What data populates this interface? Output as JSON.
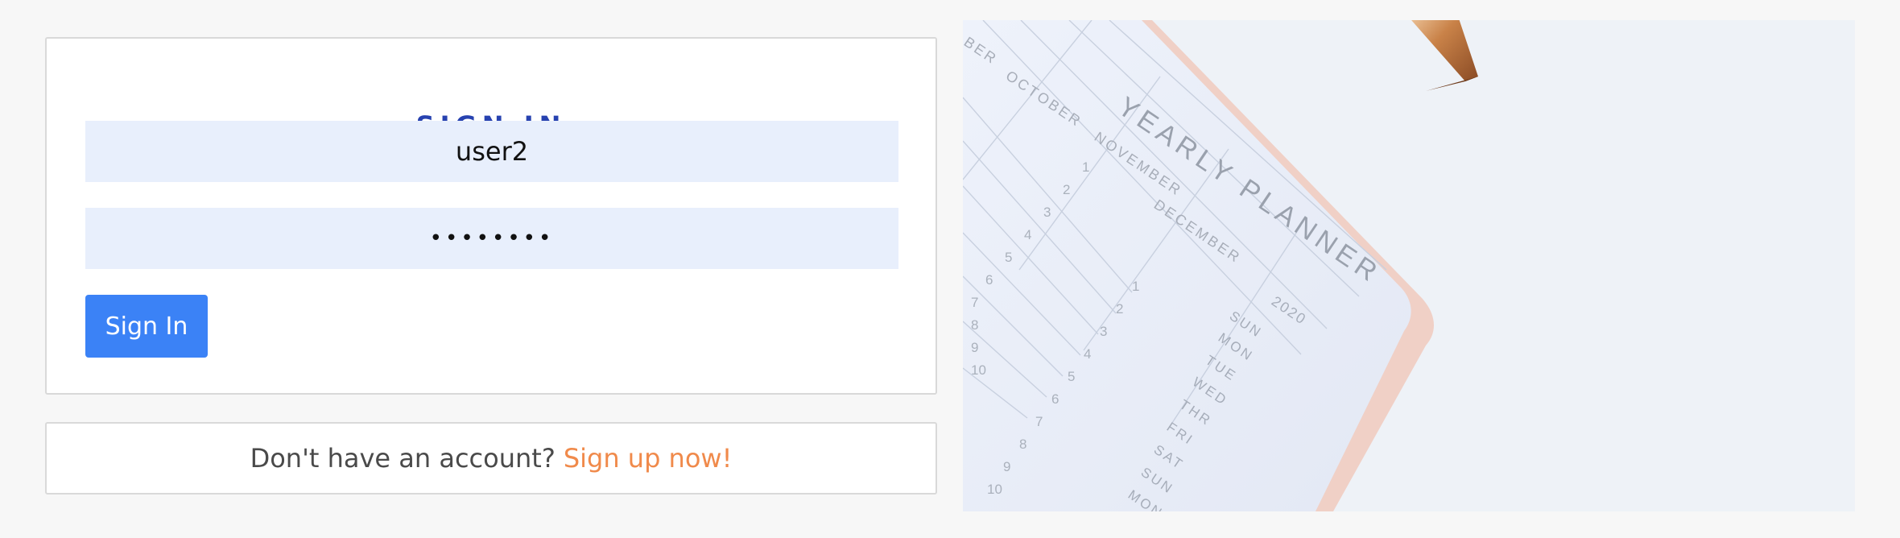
{
  "signin": {
    "title": "SIGN IN",
    "username_value": "user2",
    "password_value": "••••••••",
    "submit_label": "Sign In"
  },
  "signup": {
    "prompt": "Don't have an account?",
    "link_label": "Sign up now!"
  },
  "hero": {
    "planner_title": "YEARLY PLANNER",
    "year": "2020",
    "months": [
      "BER",
      "OCTOBER",
      "NOVEMBER",
      "DECEMBER"
    ],
    "weekdays": [
      "SUN",
      "MON",
      "TUE",
      "WED",
      "THR",
      "FRI",
      "SAT",
      "SUN",
      "MON"
    ],
    "day_numbers_left": [
      "1",
      "2",
      "3",
      "4",
      "5",
      "6",
      "7",
      "8",
      "9",
      "10"
    ],
    "day_numbers_right": [
      "1",
      "2",
      "3",
      "4",
      "5",
      "6",
      "7",
      "8",
      "9",
      "10"
    ]
  },
  "colors": {
    "title": "#2742b0",
    "button": "#3b82f6",
    "link": "#f08a4b",
    "field": "#e8effc"
  }
}
